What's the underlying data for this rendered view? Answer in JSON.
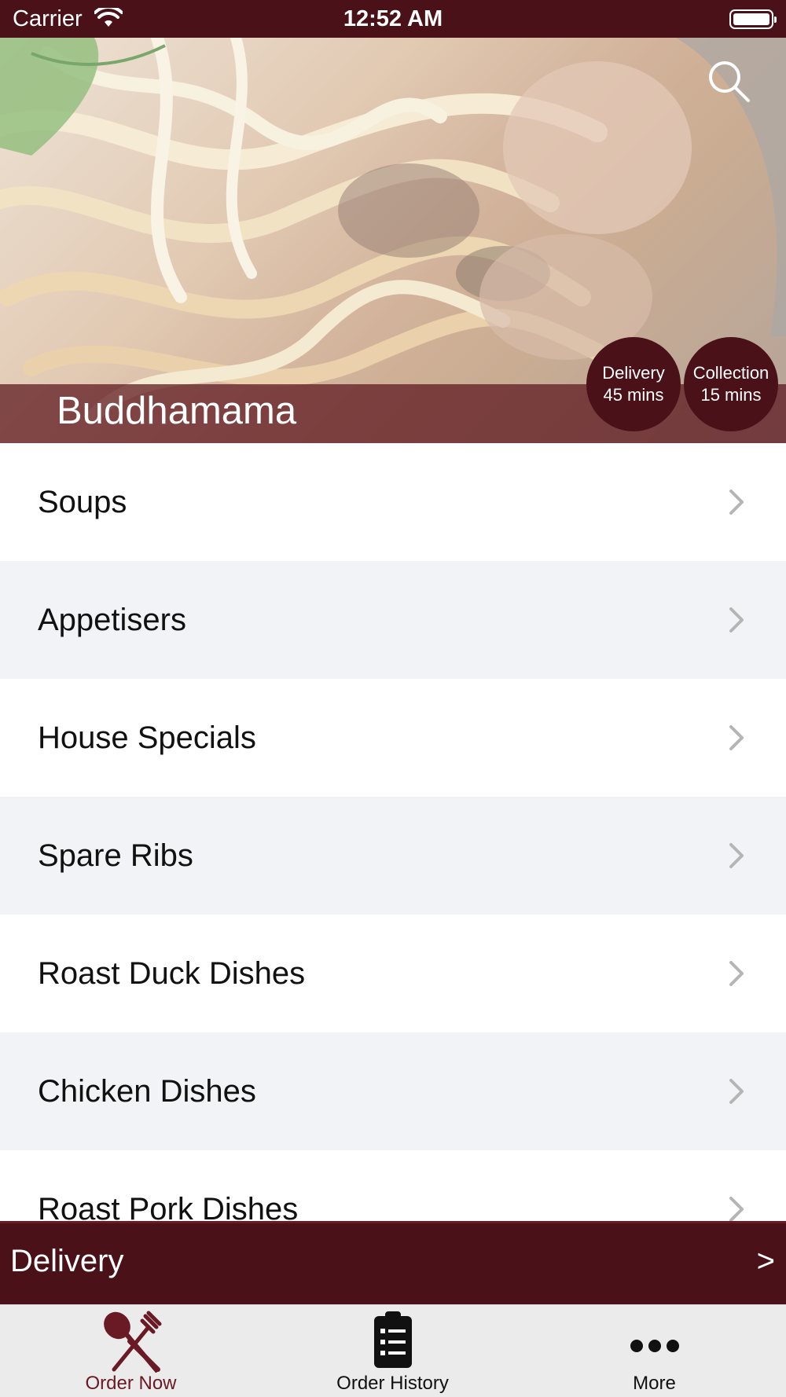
{
  "status_bar": {
    "carrier": "Carrier",
    "time": "12:52 AM"
  },
  "hero": {
    "restaurant_name": "Buddhamama",
    "delivery_badge": {
      "title": "Delivery",
      "time": "45 mins"
    },
    "collection_badge": {
      "title": "Collection",
      "time": "15 mins"
    },
    "search_icon": "search-icon"
  },
  "menu": {
    "categories": [
      {
        "label": "Soups"
      },
      {
        "label": "Appetisers"
      },
      {
        "label": "House Specials"
      },
      {
        "label": "Spare Ribs"
      },
      {
        "label": "Roast Duck Dishes"
      },
      {
        "label": "Chicken Dishes"
      },
      {
        "label": "Roast Pork Dishes"
      }
    ]
  },
  "delivery_bar": {
    "label": "Delivery",
    "arrow": ">"
  },
  "tab_bar": {
    "tabs": [
      {
        "label": "Order Now",
        "icon": "fork-knife-icon",
        "active": true
      },
      {
        "label": "Order History",
        "icon": "clipboard-list-icon",
        "active": false
      },
      {
        "label": "More",
        "icon": "more-dots-icon",
        "active": false
      }
    ]
  },
  "colors": {
    "brand": "#4a1118",
    "active_tab": "#6a1a24",
    "row_alt": "#f2f3f6",
    "tab_bar_bg": "#ebebeb"
  }
}
